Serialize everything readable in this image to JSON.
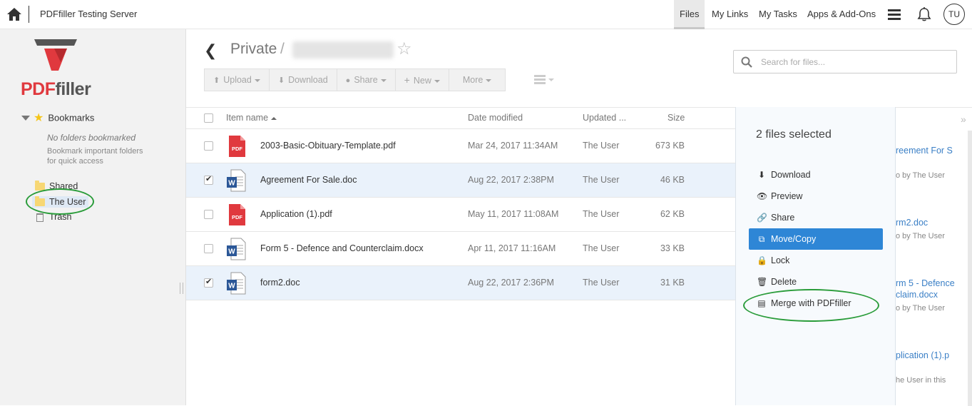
{
  "topbar": {
    "server_title": "PDFfiller Testing Server",
    "nav": [
      {
        "label": "Files",
        "active": true
      },
      {
        "label": "My Links",
        "active": false
      },
      {
        "label": "My Tasks",
        "active": false
      },
      {
        "label": "Apps & Add-Ons",
        "active": false
      }
    ],
    "avatar_initials": "TU"
  },
  "sidebar": {
    "logo_text_red": "PDF",
    "logo_text_gray": "filler",
    "bookmarks_label": "Bookmarks",
    "bookmarks_empty": "No folders bookmarked",
    "bookmarks_hint": "Bookmark important folders for quick access",
    "folders": [
      {
        "label": "Shared",
        "icon": "folder-icon"
      },
      {
        "label": "The User",
        "icon": "folder-icon",
        "selected": true
      },
      {
        "label": "Trash",
        "icon": "trash-icon"
      }
    ]
  },
  "breadcrumb": {
    "root": "Private",
    "separator": "/"
  },
  "toolbar": {
    "upload": "Upload",
    "download": "Download",
    "share": "Share",
    "new": "New",
    "more": "More"
  },
  "search": {
    "placeholder": "Search for files..."
  },
  "table": {
    "headers": {
      "name": "Item name",
      "date": "Date modified",
      "updated": "Updated ...",
      "size": "Size"
    },
    "rows": [
      {
        "name": "2003-Basic-Obituary-Template.pdf",
        "type": "pdf",
        "date": "Mar 24, 2017 11:34AM",
        "updated_by": "The User",
        "size": "673 KB",
        "checked": false
      },
      {
        "name": "Agreement For Sale.doc",
        "type": "doc",
        "date": "Aug 22, 2017 2:38PM",
        "updated_by": "The User",
        "size": "46 KB",
        "checked": true
      },
      {
        "name": "Application (1).pdf",
        "type": "pdf",
        "date": "May 11, 2017 11:08AM",
        "updated_by": "The User",
        "size": "62 KB",
        "checked": false
      },
      {
        "name": "Form 5 - Defence and Counterclaim.docx",
        "type": "doc",
        "date": "Apr 11, 2017 11:16AM",
        "updated_by": "The User",
        "size": "33 KB",
        "checked": false
      },
      {
        "name": "form2.doc",
        "type": "doc",
        "date": "Aug 22, 2017 2:36PM",
        "updated_by": "The User",
        "size": "31 KB",
        "checked": true
      }
    ],
    "pdf_badge": "PDF",
    "doc_badge": "W"
  },
  "context_panel": {
    "title": "2 files selected",
    "actions": [
      {
        "label": "Download",
        "icon": "download-icon",
        "glyph": "⬇"
      },
      {
        "label": "Preview",
        "icon": "eye-icon",
        "glyph": "👁"
      },
      {
        "label": "Share",
        "icon": "link-icon",
        "glyph": "🔗"
      },
      {
        "label": "Move/Copy",
        "icon": "copy-icon",
        "glyph": "⧉",
        "active": true
      },
      {
        "label": "Lock",
        "icon": "lock-icon",
        "glyph": "🔒"
      },
      {
        "label": "Delete",
        "icon": "trash-icon",
        "glyph": "🗑"
      },
      {
        "label": "Merge with PDFfiller",
        "icon": "merge-icon",
        "glyph": "▤"
      }
    ]
  },
  "activity_peek": {
    "items": [
      {
        "link": "reement For S",
        "meta": "o by The User"
      },
      {
        "link": "rm2.doc",
        "meta": "o by The User"
      },
      {
        "link": "rm 5 - Defence",
        "link2": "claim.docx",
        "meta": "o by The User"
      },
      {
        "link": "plication (1).p",
        "meta": "he User in this"
      }
    ]
  },
  "colors": {
    "accent": "#2e86d6",
    "highlight_circle": "#2a9c3a",
    "pdf_red": "#e0393e",
    "word_blue": "#2b5797"
  }
}
